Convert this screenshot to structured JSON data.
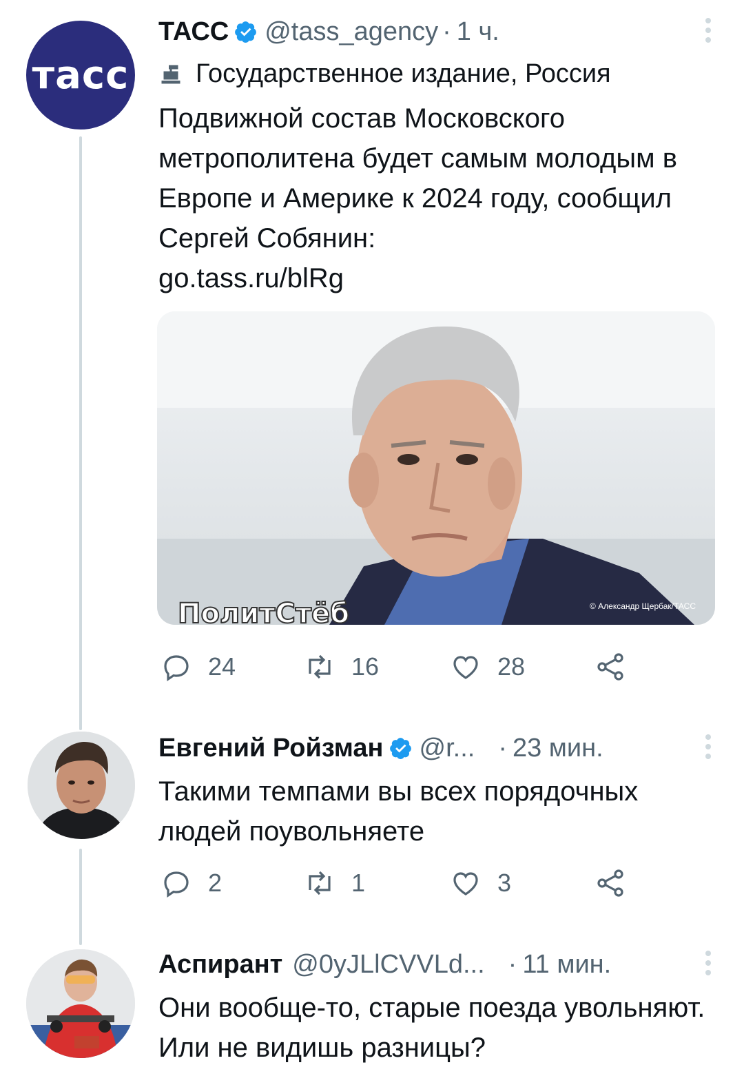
{
  "thread": {
    "tweet1": {
      "avatar_text": "тасс",
      "name": "ТАСС",
      "handle": "@tass_agency",
      "separator": "·",
      "time": "1 ч.",
      "label": "Государственное издание, Россия",
      "text": "Подвижной состав Московского метрополитена будет самым молодым в Европе и Америке к 2024 году, сообщил Сергей Собянин:",
      "link": "go.tass.ru/blRg",
      "photo_credit": "© Александр Щербак/ТАСС",
      "watermark": "ПолитСтёб",
      "replies": "24",
      "retweets": "16",
      "likes": "28"
    },
    "tweet2": {
      "name": "Евгений Ройзман",
      "handle": "@r...",
      "separator": "·",
      "time": "23 мин.",
      "text": "Такими темпами вы всех порядочных людей поувольняете",
      "replies": "2",
      "retweets": "1",
      "likes": "3"
    },
    "tweet3": {
      "name": "Аспирант",
      "handle": "@0yJLlCVVLd...",
      "separator": "·",
      "time": "11 мин.",
      "text": "Они вообще-то, старые поезда увольняют. Или не видишь разницы?"
    }
  },
  "icons": [
    "verified-badge-icon",
    "government-label-icon",
    "reply-icon",
    "retweet-icon",
    "like-icon",
    "share-icon",
    "more-options-icon"
  ],
  "colors": {
    "tass_avatar_bg": "#2b2d7c",
    "verified": "#1d9bf0",
    "secondary_text": "#536471",
    "thread_line": "#cfd9de"
  }
}
